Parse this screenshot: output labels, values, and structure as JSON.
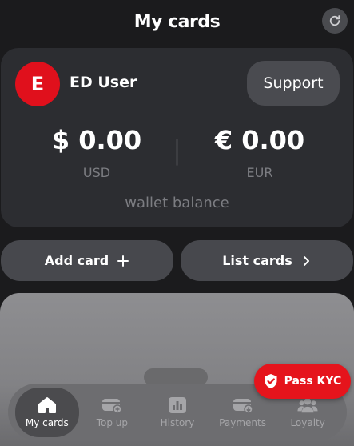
{
  "header": {
    "title": "My cards",
    "refresh_icon": "refresh-icon"
  },
  "profile": {
    "avatar_letter": "E",
    "avatar_color": "#e0101c",
    "name": "ED User",
    "support_label": "Support"
  },
  "balances": [
    {
      "amount": "$ 0.00",
      "currency": "USD"
    },
    {
      "amount": "€ 0.00",
      "currency": "EUR"
    }
  ],
  "wallet_caption": "wallet balance",
  "actions": {
    "add_card_label": "Add card",
    "list_cards_label": "List cards"
  },
  "kyc": {
    "label": "Pass KYC",
    "color": "#e5141c"
  },
  "nav": {
    "items": [
      {
        "label": "My cards",
        "icon": "home-icon",
        "active": true
      },
      {
        "label": "Top up",
        "icon": "top-up-icon",
        "active": false
      },
      {
        "label": "History",
        "icon": "history-icon",
        "active": false
      },
      {
        "label": "Payments",
        "icon": "payments-icon",
        "active": false
      },
      {
        "label": "Loyalty",
        "icon": "loyalty-icon",
        "active": false
      }
    ]
  }
}
